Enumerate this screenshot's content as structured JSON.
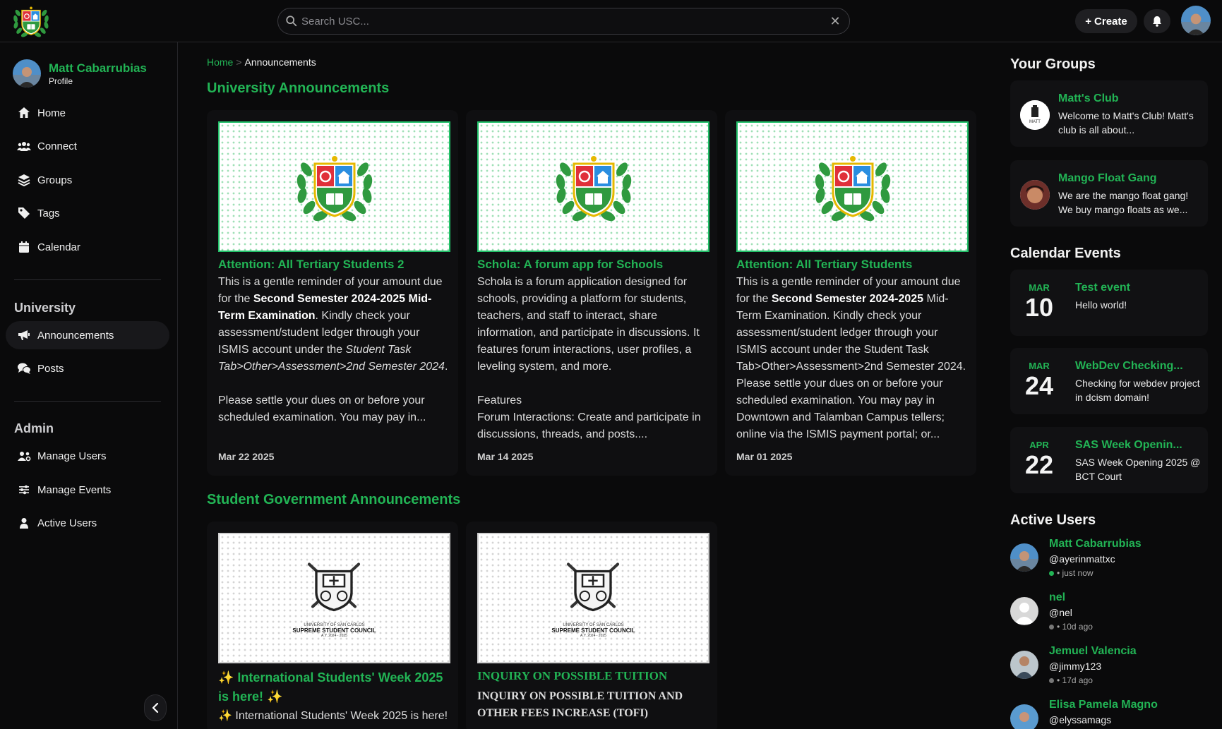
{
  "header": {
    "search_placeholder": "Search USC...",
    "create_label": "Create"
  },
  "sidebar": {
    "profile_name": "Matt Cabarrubias",
    "profile_sub": "Profile",
    "nav": [
      {
        "label": "Home",
        "icon": "home-icon"
      },
      {
        "label": "Connect",
        "icon": "users-icon"
      },
      {
        "label": "Groups",
        "icon": "layers-icon"
      },
      {
        "label": "Tags",
        "icon": "tag-icon"
      },
      {
        "label": "Calendar",
        "icon": "calendar-icon"
      }
    ],
    "university_title": "University",
    "university_items": [
      {
        "label": "Announcements",
        "icon": "megaphone-icon",
        "active": true
      },
      {
        "label": "Posts",
        "icon": "comments-icon"
      }
    ],
    "admin_title": "Admin",
    "admin_items": [
      {
        "label": "Manage Users",
        "icon": "users-cog-icon"
      },
      {
        "label": "Manage Events",
        "icon": "sliders-icon"
      },
      {
        "label": "Active Users",
        "icon": "user-icon"
      }
    ]
  },
  "breadcrumb": {
    "home": "Home",
    "sep": ">",
    "current": "Announcements"
  },
  "main": {
    "university_heading": "University Announcements",
    "student_gov_heading": "Student Government Announcements",
    "university_cards": [
      {
        "title": "Attention: All Tertiary Students 2",
        "body_1": "This is a gentle reminder of your amount due for the ",
        "body_bold_1": "Second Semester 2024-2025 Mid-Term Examination",
        "body_2": ". Kindly check your assessment/student ledger through your ISMIS account under the ",
        "body_italic": "Student Task Tab>Other>Assessment>2nd Semester 2024",
        "body_3": ".",
        "body_4": "Please settle your dues on or before your scheduled examination. You may pay in...",
        "date": "Mar 22 2025"
      },
      {
        "title": "Schola: A forum app for Schools",
        "body_1": "Schola is a forum application designed for schools, providing a platform for students, teachers, and staff to interact, share information, and participate in discussions. It features forum interactions, user profiles, a leveling system, and more.",
        "body_2": "Features",
        "body_3": "Forum Interactions: Create and participate in discussions, threads, and posts....",
        "date": "Mar 14 2025"
      },
      {
        "title": "Attention: All Tertiary Students",
        "body_1": "This is a gentle reminder of your amount due for the ",
        "body_bold_1": "Second Semester 2024-2025",
        "body_2": " Mid-Term Examination. Kindly check your assessment/student ledger through your ISMIS account under the Student Task Tab>Other>Assessment>2nd Semester 2024. Please settle your dues on or before your scheduled examination. You may pay in Downtown and Talamban Campus tellers; online via the ISMIS payment portal; or...",
        "date": "Mar 01 2025"
      }
    ],
    "student_gov_cards": [
      {
        "title": "✨ International Students' Week 2025 is here! ✨",
        "body": "✨ International Students' Week 2025 is here!"
      },
      {
        "title": "INQUIRY ON POSSIBLE TUITION",
        "body": "INQUIRY ON POSSIBLE TUITION AND OTHER FEES INCREASE (TOFI)"
      }
    ],
    "ssc_logo_text_1": "UNIVERSITY OF SAN CARLOS",
    "ssc_logo_text_2": "SUPREME STUDENT COUNCIL",
    "ssc_logo_text_3": "A.Y. 2024 - 2025"
  },
  "right": {
    "groups_heading": "Your Groups",
    "groups": [
      {
        "name": "Matt's Club",
        "desc": "Welcome to Matt's Club! Matt's club is all about..."
      },
      {
        "name": "Mango Float Gang",
        "desc": "We are the mango float gang! We buy mango floats as we..."
      }
    ],
    "groups_logo_text": "MATT",
    "events_heading": "Calendar Events",
    "events": [
      {
        "month": "MAR",
        "day": "10",
        "title": "Test event",
        "desc": "Hello world!"
      },
      {
        "month": "MAR",
        "day": "24",
        "title": "WebDev Checking...",
        "desc": "Checking for webdev project in dcism domain!"
      },
      {
        "month": "APR",
        "day": "22",
        "title": "SAS Week Openin...",
        "desc": "SAS Week Opening 2025 @ BCT Court"
      }
    ],
    "active_heading": "Active Users",
    "users": [
      {
        "name": "Matt Cabarrubias",
        "handle": "@ayerinmattxc",
        "seen": "• just now",
        "online": true
      },
      {
        "name": "nel",
        "handle": "@nel",
        "seen": "• 10d ago",
        "online": false
      },
      {
        "name": "Jemuel Valencia",
        "handle": "@jimmy123",
        "seen": "• 17d ago",
        "online": false
      },
      {
        "name": "Elisa Pamela Magno",
        "handle": "@elyssamags",
        "seen": "",
        "online": false
      }
    ]
  },
  "colors": {
    "accent": "#22b455",
    "background": "#0a0a0b",
    "card": "#0f0f11",
    "online": "#22b455",
    "offline": "#777777"
  }
}
